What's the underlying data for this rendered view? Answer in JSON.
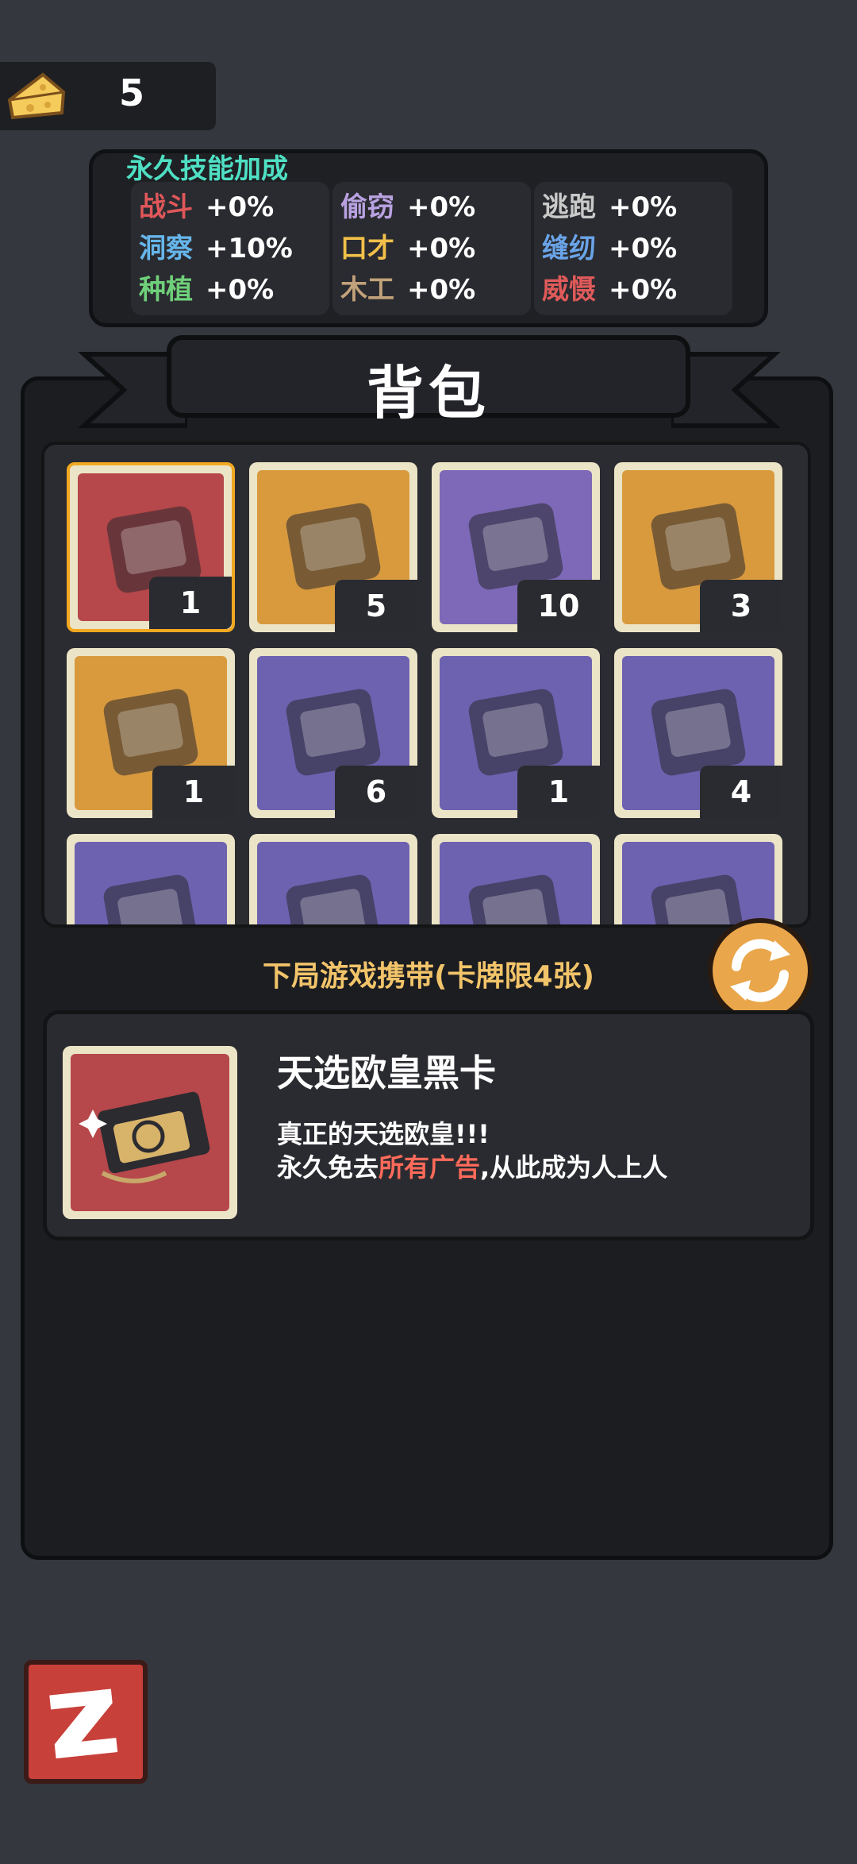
{
  "currency": {
    "icon": "cheese-icon",
    "count": "5"
  },
  "skills": {
    "title": "永久技能加成",
    "columns": [
      [
        {
          "name": "战斗",
          "value": "+0%",
          "color": "#e0575a"
        },
        {
          "name": "洞察",
          "value": "+10%",
          "color": "#66b6ea"
        },
        {
          "name": "种植",
          "value": "+0%",
          "color": "#6fd07a"
        }
      ],
      [
        {
          "name": "偷窃",
          "value": "+0%",
          "color": "#b9a2e2"
        },
        {
          "name": "口才",
          "value": "+0%",
          "color": "#f2c04a"
        },
        {
          "name": "木工",
          "value": "+0%",
          "color": "#c2a27a"
        }
      ],
      [
        {
          "name": "逃跑",
          "value": "+0%",
          "color": "#c9c9c9"
        },
        {
          "name": "缝纫",
          "value": "+0%",
          "color": "#6aa4e8"
        },
        {
          "name": "威慑",
          "value": "+0%",
          "color": "#e05a5a"
        }
      ]
    ]
  },
  "bag": {
    "title": "背包",
    "items": [
      {
        "name": "black-card",
        "qty": "1",
        "bg": "#b6474a",
        "selected": true
      },
      {
        "name": "ad-removal-pack",
        "qty": "5",
        "bg": "#d99a3e"
      },
      {
        "name": "purple-card-box",
        "qty": "10",
        "bg": "#7d69b8"
      },
      {
        "name": "stone-mouse-tablet",
        "qty": "3",
        "bg": "#d99a3e"
      },
      {
        "name": "steak-bag",
        "qty": "1",
        "bg": "#d99a3e"
      },
      {
        "name": "blue-notes-bag",
        "qty": "6",
        "bg": "#6d62b0"
      },
      {
        "name": "wallet-coins",
        "qty": "1",
        "bg": "#6d62b0"
      },
      {
        "name": "first-aid-kit",
        "qty": "4",
        "bg": "#6d62b0"
      },
      {
        "name": "paper-bag",
        "qty": "",
        "bg": "#6d62b0"
      },
      {
        "name": "blue-tin-box",
        "qty": "",
        "bg": "#6d62b0"
      },
      {
        "name": "sauce-bottle",
        "qty": "",
        "bg": "#6d62b0"
      },
      {
        "name": "green-packet",
        "qty": "",
        "bg": "#6d62b0"
      }
    ]
  },
  "carry_label": "下局游戏携带(卡牌限4张)",
  "detail": {
    "name": "天选欧皇黑卡",
    "desc_line1": "真正的天选欧皇!!!",
    "desc_line2_pre": "永久免去",
    "desc_line2_hl": "所有广告",
    "desc_line2_post": ",从此成为人上人"
  },
  "buttons": {
    "back": "back-icon",
    "refresh": "refresh-icon"
  }
}
